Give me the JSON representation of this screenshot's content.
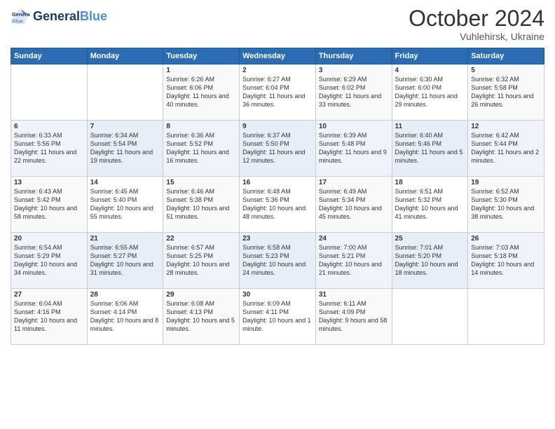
{
  "logo": {
    "line1": "General",
    "line2": "Blue"
  },
  "header": {
    "month": "October 2024",
    "location": "Vuhlehirsk, Ukraine"
  },
  "days_of_week": [
    "Sunday",
    "Monday",
    "Tuesday",
    "Wednesday",
    "Thursday",
    "Friday",
    "Saturday"
  ],
  "weeks": [
    [
      {
        "day": "",
        "sunrise": "",
        "sunset": "",
        "daylight": ""
      },
      {
        "day": "",
        "sunrise": "",
        "sunset": "",
        "daylight": ""
      },
      {
        "day": "1",
        "sunrise": "Sunrise: 6:26 AM",
        "sunset": "Sunset: 6:06 PM",
        "daylight": "Daylight: 11 hours and 40 minutes."
      },
      {
        "day": "2",
        "sunrise": "Sunrise: 6:27 AM",
        "sunset": "Sunset: 6:04 PM",
        "daylight": "Daylight: 11 hours and 36 minutes."
      },
      {
        "day": "3",
        "sunrise": "Sunrise: 6:29 AM",
        "sunset": "Sunset: 6:02 PM",
        "daylight": "Daylight: 11 hours and 33 minutes."
      },
      {
        "day": "4",
        "sunrise": "Sunrise: 6:30 AM",
        "sunset": "Sunset: 6:00 PM",
        "daylight": "Daylight: 11 hours and 29 minutes."
      },
      {
        "day": "5",
        "sunrise": "Sunrise: 6:32 AM",
        "sunset": "Sunset: 5:58 PM",
        "daylight": "Daylight: 11 hours and 26 minutes."
      }
    ],
    [
      {
        "day": "6",
        "sunrise": "Sunrise: 6:33 AM",
        "sunset": "Sunset: 5:56 PM",
        "daylight": "Daylight: 11 hours and 22 minutes."
      },
      {
        "day": "7",
        "sunrise": "Sunrise: 6:34 AM",
        "sunset": "Sunset: 5:54 PM",
        "daylight": "Daylight: 11 hours and 19 minutes."
      },
      {
        "day": "8",
        "sunrise": "Sunrise: 6:36 AM",
        "sunset": "Sunset: 5:52 PM",
        "daylight": "Daylight: 11 hours and 16 minutes."
      },
      {
        "day": "9",
        "sunrise": "Sunrise: 6:37 AM",
        "sunset": "Sunset: 5:50 PM",
        "daylight": "Daylight: 11 hours and 12 minutes."
      },
      {
        "day": "10",
        "sunrise": "Sunrise: 6:39 AM",
        "sunset": "Sunset: 5:48 PM",
        "daylight": "Daylight: 11 hours and 9 minutes."
      },
      {
        "day": "11",
        "sunrise": "Sunrise: 6:40 AM",
        "sunset": "Sunset: 5:46 PM",
        "daylight": "Daylight: 11 hours and 5 minutes."
      },
      {
        "day": "12",
        "sunrise": "Sunrise: 6:42 AM",
        "sunset": "Sunset: 5:44 PM",
        "daylight": "Daylight: 11 hours and 2 minutes."
      }
    ],
    [
      {
        "day": "13",
        "sunrise": "Sunrise: 6:43 AM",
        "sunset": "Sunset: 5:42 PM",
        "daylight": "Daylight: 10 hours and 58 minutes."
      },
      {
        "day": "14",
        "sunrise": "Sunrise: 6:45 AM",
        "sunset": "Sunset: 5:40 PM",
        "daylight": "Daylight: 10 hours and 55 minutes."
      },
      {
        "day": "15",
        "sunrise": "Sunrise: 6:46 AM",
        "sunset": "Sunset: 5:38 PM",
        "daylight": "Daylight: 10 hours and 51 minutes."
      },
      {
        "day": "16",
        "sunrise": "Sunrise: 6:48 AM",
        "sunset": "Sunset: 5:36 PM",
        "daylight": "Daylight: 10 hours and 48 minutes."
      },
      {
        "day": "17",
        "sunrise": "Sunrise: 6:49 AM",
        "sunset": "Sunset: 5:34 PM",
        "daylight": "Daylight: 10 hours and 45 minutes."
      },
      {
        "day": "18",
        "sunrise": "Sunrise: 6:51 AM",
        "sunset": "Sunset: 5:32 PM",
        "daylight": "Daylight: 10 hours and 41 minutes."
      },
      {
        "day": "19",
        "sunrise": "Sunrise: 6:52 AM",
        "sunset": "Sunset: 5:30 PM",
        "daylight": "Daylight: 10 hours and 38 minutes."
      }
    ],
    [
      {
        "day": "20",
        "sunrise": "Sunrise: 6:54 AM",
        "sunset": "Sunset: 5:29 PM",
        "daylight": "Daylight: 10 hours and 34 minutes."
      },
      {
        "day": "21",
        "sunrise": "Sunrise: 6:55 AM",
        "sunset": "Sunset: 5:27 PM",
        "daylight": "Daylight: 10 hours and 31 minutes."
      },
      {
        "day": "22",
        "sunrise": "Sunrise: 6:57 AM",
        "sunset": "Sunset: 5:25 PM",
        "daylight": "Daylight: 10 hours and 28 minutes."
      },
      {
        "day": "23",
        "sunrise": "Sunrise: 6:58 AM",
        "sunset": "Sunset: 5:23 PM",
        "daylight": "Daylight: 10 hours and 24 minutes."
      },
      {
        "day": "24",
        "sunrise": "Sunrise: 7:00 AM",
        "sunset": "Sunset: 5:21 PM",
        "daylight": "Daylight: 10 hours and 21 minutes."
      },
      {
        "day": "25",
        "sunrise": "Sunrise: 7:01 AM",
        "sunset": "Sunset: 5:20 PM",
        "daylight": "Daylight: 10 hours and 18 minutes."
      },
      {
        "day": "26",
        "sunrise": "Sunrise: 7:03 AM",
        "sunset": "Sunset: 5:18 PM",
        "daylight": "Daylight: 10 hours and 14 minutes."
      }
    ],
    [
      {
        "day": "27",
        "sunrise": "Sunrise: 6:04 AM",
        "sunset": "Sunset: 4:16 PM",
        "daylight": "Daylight: 10 hours and 11 minutes."
      },
      {
        "day": "28",
        "sunrise": "Sunrise: 6:06 AM",
        "sunset": "Sunset: 4:14 PM",
        "daylight": "Daylight: 10 hours and 8 minutes."
      },
      {
        "day": "29",
        "sunrise": "Sunrise: 6:08 AM",
        "sunset": "Sunset: 4:13 PM",
        "daylight": "Daylight: 10 hours and 5 minutes."
      },
      {
        "day": "30",
        "sunrise": "Sunrise: 6:09 AM",
        "sunset": "Sunset: 4:11 PM",
        "daylight": "Daylight: 10 hours and 1 minute."
      },
      {
        "day": "31",
        "sunrise": "Sunrise: 6:11 AM",
        "sunset": "Sunset: 4:09 PM",
        "daylight": "Daylight: 9 hours and 58 minutes."
      },
      {
        "day": "",
        "sunrise": "",
        "sunset": "",
        "daylight": ""
      },
      {
        "day": "",
        "sunrise": "",
        "sunset": "",
        "daylight": ""
      }
    ]
  ]
}
